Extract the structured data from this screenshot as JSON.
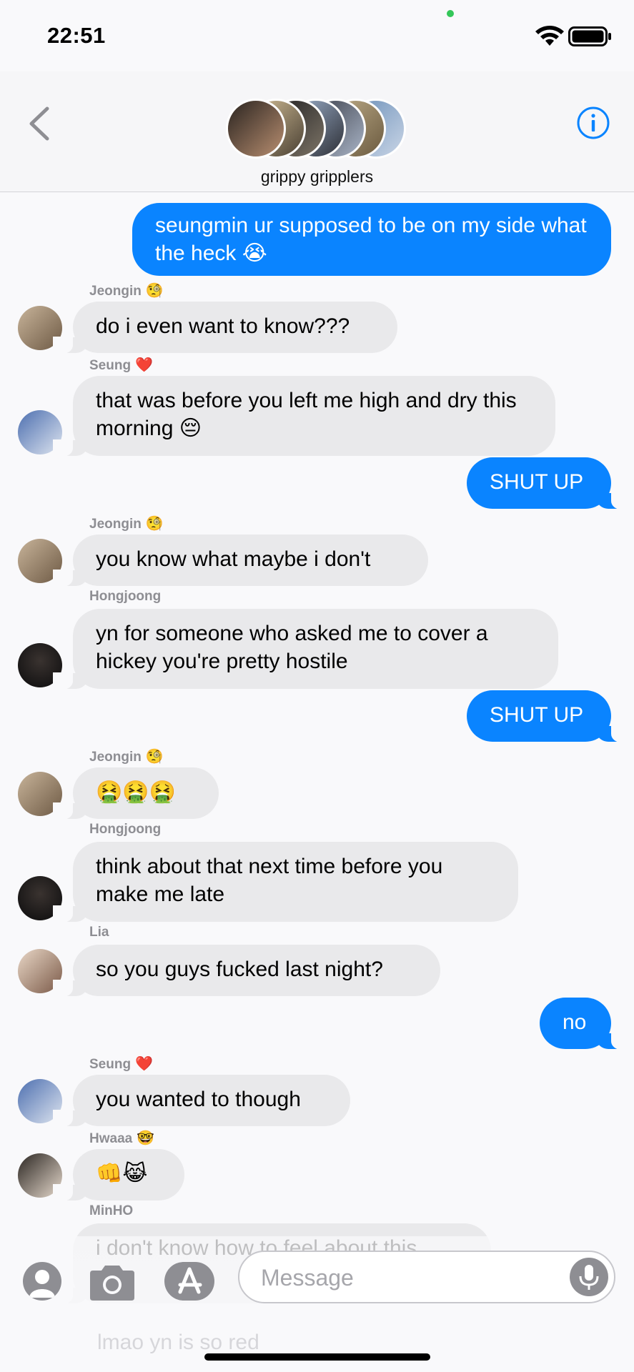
{
  "status_bar": {
    "time": "22:51"
  },
  "header": {
    "group_name": "grippy gripplers"
  },
  "messages": [
    {
      "text": "seungmin ur supposed to be on my side what the heck 😭"
    },
    {
      "sender": "Jeongin",
      "sender_emoji": "🧐",
      "text": "do i even want to know???"
    },
    {
      "sender": "Seung",
      "sender_emoji": "❤️",
      "text": "that was before you left me high and dry this morning 😔"
    },
    {
      "text": "SHUT UP"
    },
    {
      "sender": "Jeongin",
      "sender_emoji": "🧐",
      "text": "you know what maybe i don't"
    },
    {
      "sender": "Hongjoong",
      "text": "yn for someone who asked me to cover a hickey you're pretty hostile"
    },
    {
      "text": "SHUT UP"
    },
    {
      "sender": "Jeongin",
      "sender_emoji": "🧐",
      "text": "🤮🤮🤮"
    },
    {
      "sender": "Hongjoong",
      "text": "think about that next time before you make me late"
    },
    {
      "sender": "Lia",
      "text": "so you guys fucked last night?"
    },
    {
      "text": "no"
    },
    {
      "sender": "Seung",
      "sender_emoji": "❤️",
      "text": "you wanted to though"
    },
    {
      "sender": "Hwaaa",
      "sender_emoji": "🤓",
      "text": "👊😹"
    },
    {
      "sender": "MinHO",
      "text": "i don't know how to feel about this"
    },
    {
      "text": "lmao yn is so red"
    }
  ],
  "input": {
    "placeholder": "Message"
  },
  "colors": {
    "outgoing": "#0a84ff",
    "incoming": "#e9e9eb",
    "background": "#f9f9fb"
  }
}
